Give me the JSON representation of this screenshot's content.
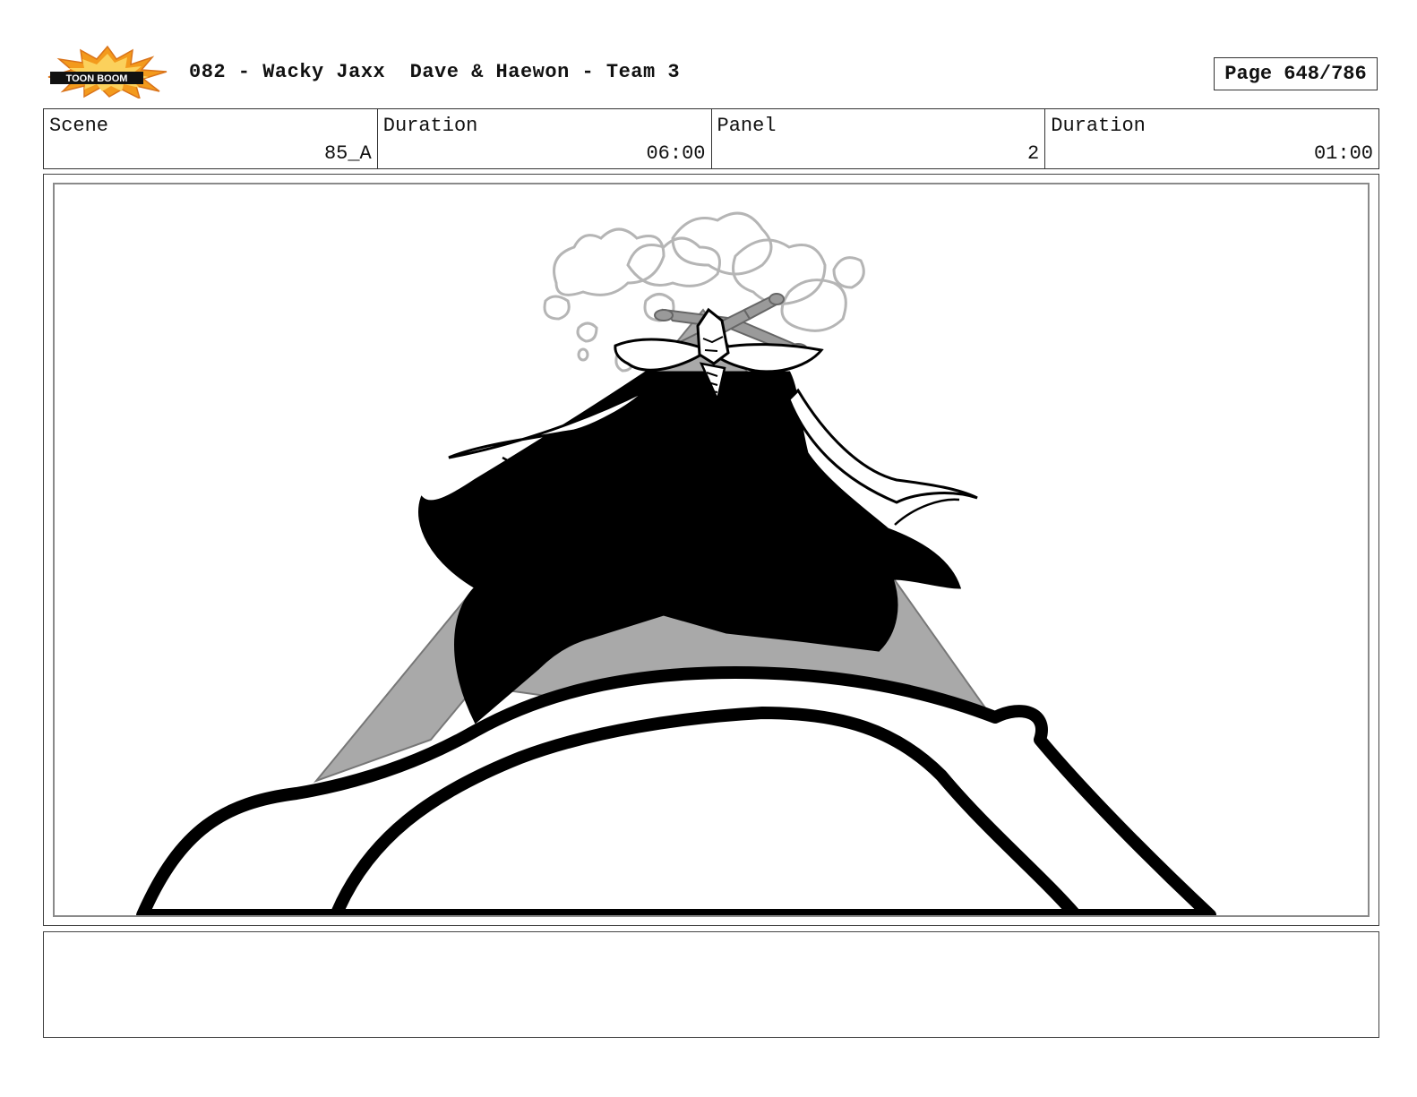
{
  "header": {
    "logo_name": "toon-boom-logo",
    "logo_text": "TOON BOOM",
    "title": "082 - Wacky Jaxx  Dave & Haewon - Team 3",
    "page": "Page 648/786"
  },
  "info": {
    "scene_label": "Scene",
    "scene_value": "85_A",
    "scene_duration_label": "Duration",
    "scene_duration_value": "06:00",
    "panel_label": "Panel",
    "panel_value": "2",
    "panel_duration_label": "Duration",
    "panel_duration_value": "01:00"
  },
  "notes": {
    "text": ""
  },
  "colors": {
    "logo_burst": "#f39a1c",
    "ink": "#000000",
    "shadow_gray": "#a9a9a9",
    "smoke_gray": "#b5b5b5",
    "frame_gray": "#8a8a8a"
  }
}
